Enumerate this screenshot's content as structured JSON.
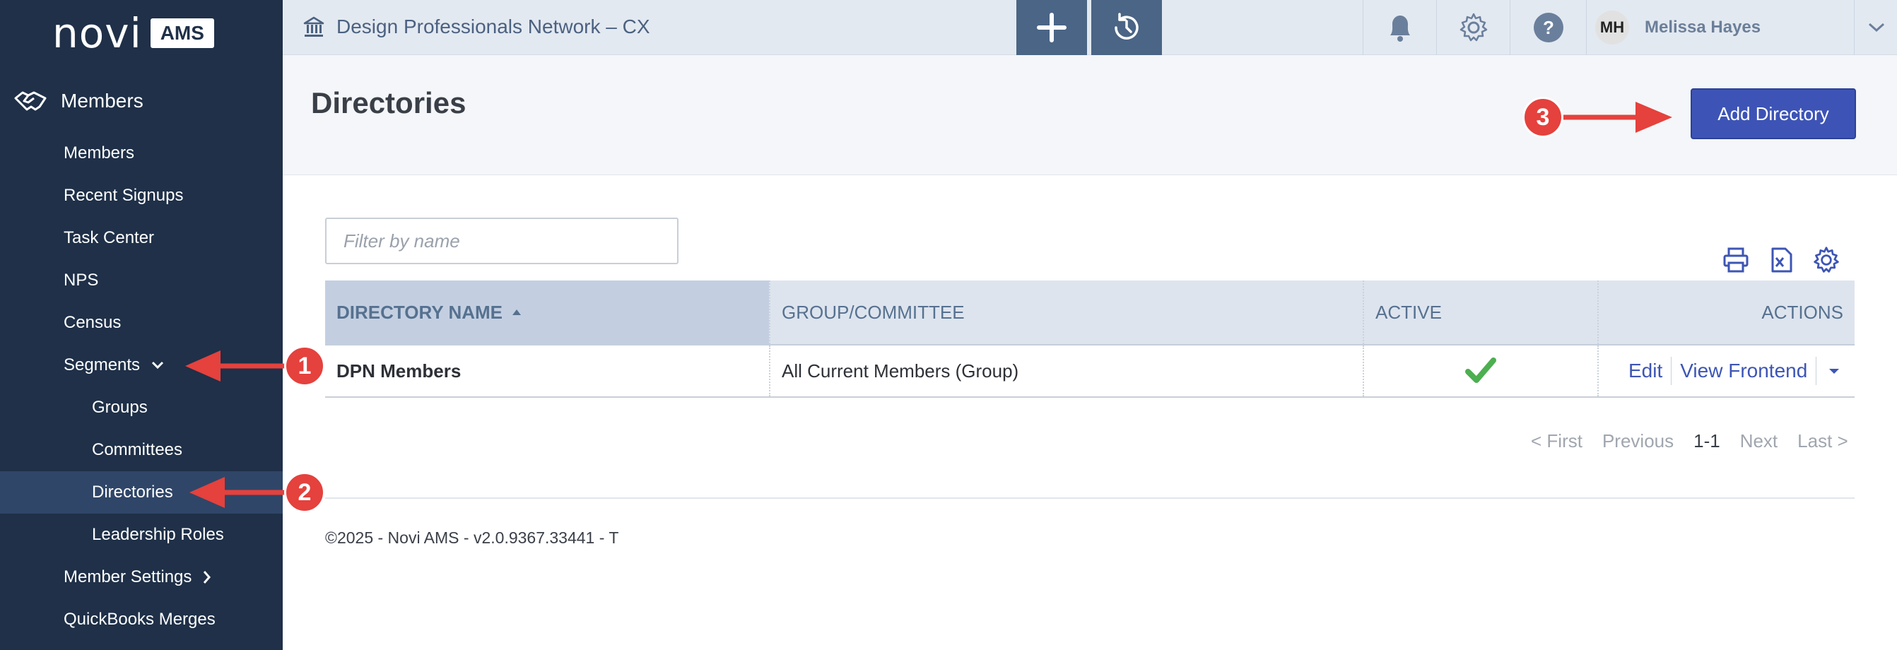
{
  "brand": {
    "name": "novi",
    "badge": "AMS"
  },
  "sidebar": {
    "section": "Members",
    "items": [
      {
        "label": "Members"
      },
      {
        "label": "Recent Signups"
      },
      {
        "label": "Task Center"
      },
      {
        "label": "NPS"
      },
      {
        "label": "Census"
      },
      {
        "label": "Segments"
      },
      {
        "label": "Groups"
      },
      {
        "label": "Committees"
      },
      {
        "label": "Directories"
      },
      {
        "label": "Leadership Roles"
      },
      {
        "label": "Member Settings"
      },
      {
        "label": "QuickBooks Merges"
      }
    ]
  },
  "topbar": {
    "org_name": "Design Professionals Network – CX",
    "user": {
      "initials": "MH",
      "name": "Melissa Hayes"
    }
  },
  "page": {
    "title": "Directories",
    "add_button": "Add Directory"
  },
  "filter": {
    "placeholder": "Filter by name"
  },
  "table": {
    "columns": [
      "DIRECTORY NAME",
      "GROUP/COMMITTEE",
      "ACTIVE",
      "ACTIONS"
    ],
    "rows": [
      {
        "name": "DPN Members",
        "group": "All Current Members (Group)",
        "active": true,
        "actions": [
          "Edit",
          "View Frontend"
        ]
      }
    ]
  },
  "pager": {
    "first": "< First",
    "previous": "Previous",
    "current": "1-1",
    "next": "Next",
    "last": "Last >"
  },
  "footer": {
    "text": "©2025 - Novi AMS - v2.0.9367.33441 - T"
  },
  "annotations": [
    "1",
    "2",
    "3"
  ],
  "colors": {
    "sidebar": "#1f3048",
    "accent": "#3d54b6",
    "annotation": "#e5413d",
    "check": "#4caf50"
  }
}
